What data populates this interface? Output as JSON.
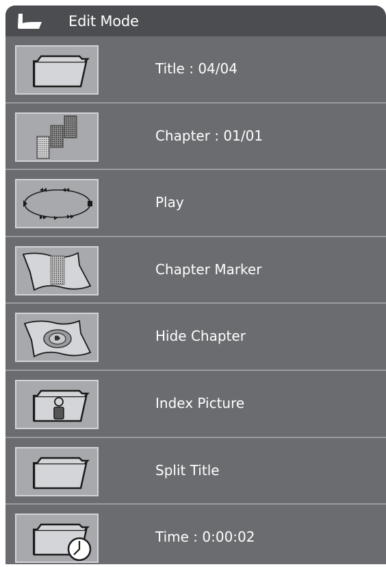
{
  "header": {
    "title": "Edit Mode",
    "back_icon": "back-arrow-icon"
  },
  "menu": {
    "items": [
      {
        "label": "Title : 04/04",
        "icon": "folder-icon"
      },
      {
        "label": "Chapter : 01/01",
        "icon": "chapter-stack-icon"
      },
      {
        "label": "Play",
        "icon": "play-loop-icon"
      },
      {
        "label": "Chapter Marker",
        "icon": "chapter-marker-icon"
      },
      {
        "label": "Hide Chapter",
        "icon": "hide-chapter-icon"
      },
      {
        "label": "Index Picture",
        "icon": "index-picture-icon"
      },
      {
        "label": "Split Title",
        "icon": "split-title-icon"
      },
      {
        "label": "Time : 0:00:02",
        "icon": "time-folder-icon"
      }
    ]
  },
  "colors": {
    "panel": "#6b6c70",
    "header": "#4c4d51",
    "thumb": "#a8a9ad",
    "text": "#ffffff"
  }
}
